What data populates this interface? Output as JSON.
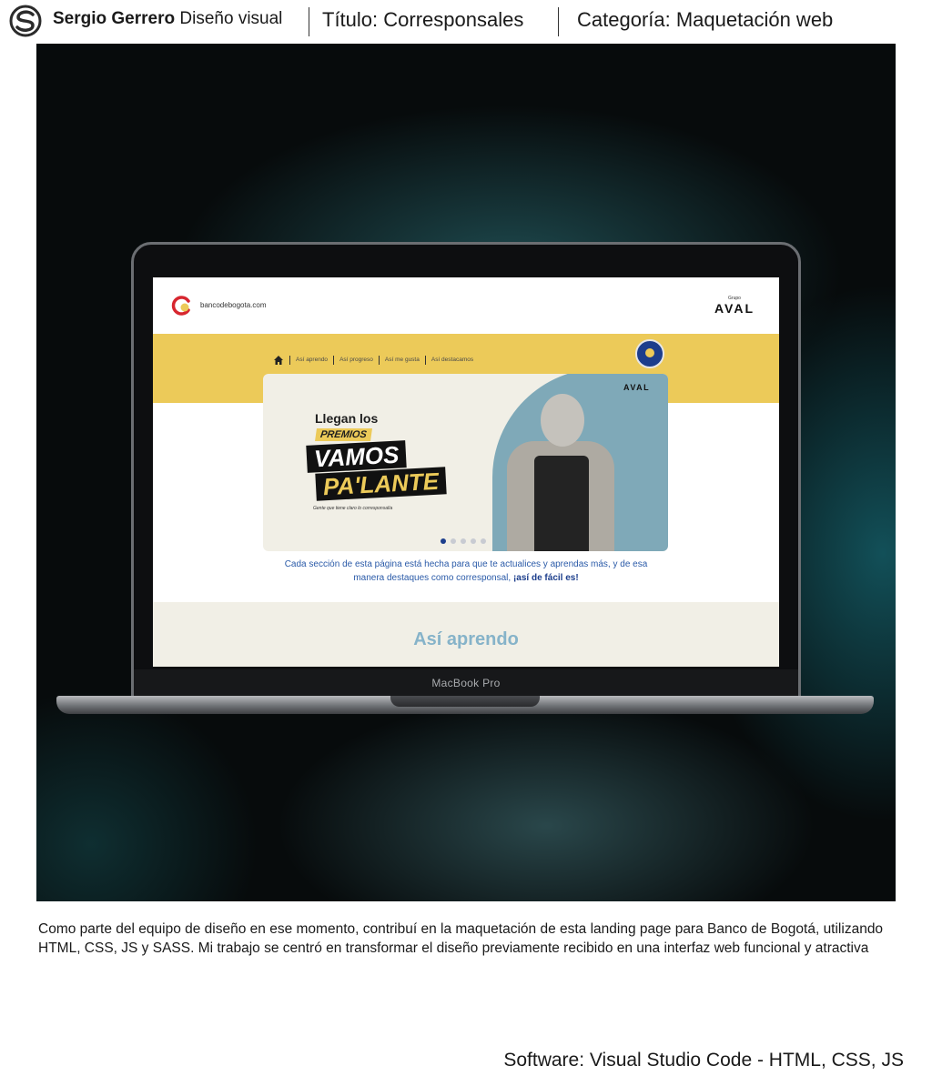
{
  "header": {
    "author_name": "Sergio Gerrero",
    "author_role": "Diseño visual",
    "title": "Título: Corresponsales",
    "category": "Categoría: Maquetación web"
  },
  "laptop": {
    "model_label": "MacBook Pro"
  },
  "website": {
    "domain": "bancodebogota.com",
    "group_small": "Grupo",
    "group_name": "AVAL",
    "nav_items": [
      "Así aprendo",
      "Así progreso",
      "Así me gusta",
      "Así destacamos"
    ],
    "banner": {
      "headline": "Llegan los",
      "premios": "PREMIOS",
      "line1": "VAMOS",
      "line2": "PA'LANTE",
      "tagline": "Gente que tiene claro lo corresponsalía",
      "brand": "AVAL",
      "active_slide": 1,
      "slide_count": 5
    },
    "intro_text": "Cada sección de esta página está hecha para que te actualices y aprendas más, y de esa manera destaques como corresponsal,",
    "intro_highlight": "¡así de fácil es!",
    "section_title": "Así aprendo",
    "colors": {
      "yellow": "#ecca59",
      "navy": "#1c3e8c",
      "light_blue": "#86b3c9",
      "cream": "#f1efe6"
    }
  },
  "description": "Como parte del equipo de diseño en ese momento, contribuí en la maquetación de esta landing page para Banco de Bogotá, utilizando HTML, CSS, JS y SASS. Mi trabajo se centró en transformar el diseño previamente recibido en una interfaz web funcional y atractiva",
  "software": "Software: Visual Studio Code - HTML, CSS, JS"
}
